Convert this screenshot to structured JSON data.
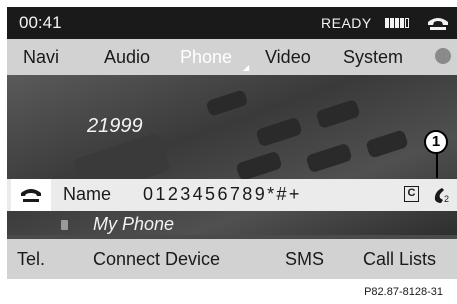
{
  "status": {
    "time": "00:41",
    "ready": "READY",
    "signal_bars": 4,
    "signal_max": 5
  },
  "menu": {
    "items": [
      "Navi",
      "Audio",
      "Phone",
      "Video",
      "System"
    ],
    "active": "Phone"
  },
  "background": {
    "dialed_number": "21999"
  },
  "callout": {
    "label": "1"
  },
  "dial_row": {
    "name_label": "Name",
    "digits": "0123456789*#+",
    "clear_label": "C",
    "redial_count": "2"
  },
  "phone": {
    "device_name": "My Phone"
  },
  "bottom": {
    "items": [
      "Tel.",
      "Connect Device",
      "SMS",
      "Call Lists"
    ]
  },
  "caption": "P82.87-8128-31",
  "colors": {
    "screen_bg": "#4a4a4a",
    "bar_bg": "#d2d2d2",
    "status_bg": "#1a1a1a",
    "active_text": "#ffffff"
  }
}
